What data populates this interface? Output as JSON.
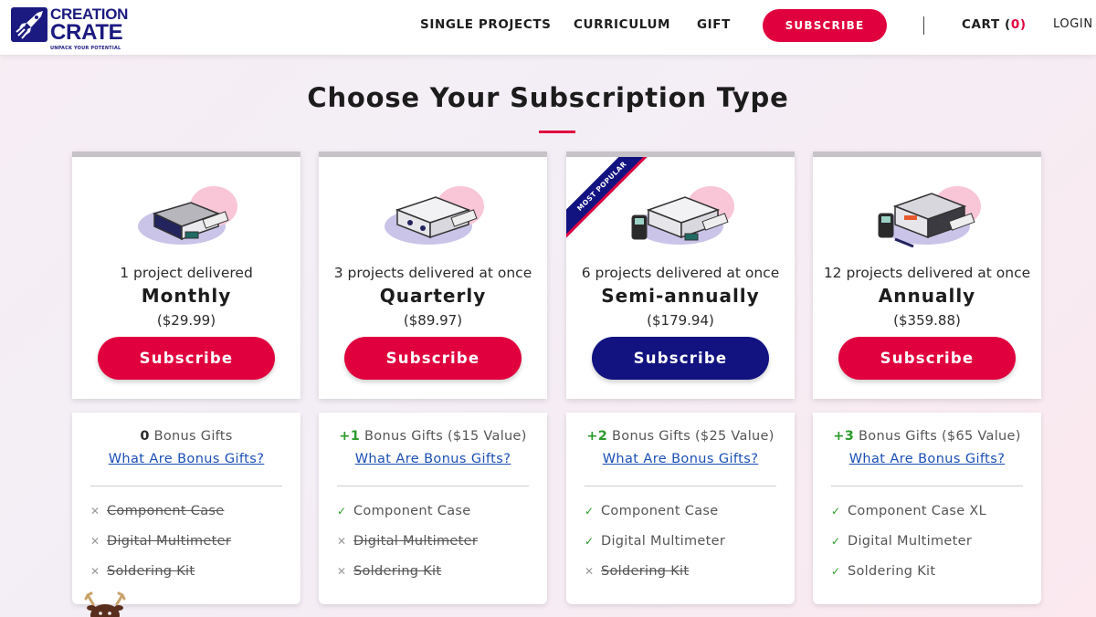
{
  "brand": {
    "line1": "CREATION",
    "line2": "CRATE",
    "tagline": "UNPACK YOUR POTENTIAL"
  },
  "nav": {
    "single_projects": "SINGLE PROJECTS",
    "curriculum": "CURRICULUM",
    "gift": "GIFT",
    "subscribe": "SUBSCRIBE",
    "cart_label": "CART (",
    "cart_count": "0",
    "cart_close": ")",
    "login": "LOGIN"
  },
  "page": {
    "title": "Choose Your Subscription Type"
  },
  "plans": [
    {
      "desc": "1 project delivered",
      "name": "Monthly",
      "price": "($29.99)",
      "button": "Subscribe",
      "bonus_count": "0",
      "bonus_text": " Bonus Gifts",
      "bonus_link": "What Are Bonus Gifts?",
      "features": [
        {
          "label": "Component Case",
          "included": false
        },
        {
          "label": "Digital Multimeter",
          "included": false
        },
        {
          "label": "Soldering Kit",
          "included": false
        }
      ]
    },
    {
      "desc": "3 projects delivered at once",
      "name": "Quarterly",
      "price": "($89.97)",
      "button": "Subscribe",
      "bonus_count": "+1",
      "bonus_text": " Bonus Gifts ($15 Value)",
      "bonus_link": "What Are Bonus Gifts?",
      "features": [
        {
          "label": "Component Case",
          "included": true
        },
        {
          "label": "Digital Multimeter",
          "included": false
        },
        {
          "label": "Soldering Kit",
          "included": false
        }
      ]
    },
    {
      "ribbon": "MOST POPULAR",
      "desc": "6 projects delivered at once",
      "name": "Semi-annually",
      "price": "($179.94)",
      "button": "Subscribe",
      "bonus_count": "+2",
      "bonus_text": " Bonus Gifts ($25 Value)",
      "bonus_link": "What Are Bonus Gifts?",
      "features": [
        {
          "label": "Component Case",
          "included": true
        },
        {
          "label": "Digital Multimeter",
          "included": true
        },
        {
          "label": "Soldering Kit",
          "included": false
        }
      ]
    },
    {
      "desc": "12 projects delivered at once",
      "name": "Annually",
      "price": "($359.88)",
      "button": "Subscribe",
      "bonus_count": "+3",
      "bonus_text": " Bonus Gifts ($65 Value)",
      "bonus_link": "What Are Bonus Gifts?",
      "features": [
        {
          "label": "Component Case XL",
          "included": true
        },
        {
          "label": "Digital Multimeter",
          "included": true
        },
        {
          "label": "Soldering Kit",
          "included": true
        }
      ]
    }
  ],
  "icons": {
    "check": "check-icon",
    "cross": "x-icon",
    "logo": "rocket-logo-icon",
    "mascot": "reindeer-icon"
  },
  "colors": {
    "accent_red": "#e0003e",
    "navy": "#121380",
    "brand_navy": "#1b1a80",
    "bonus_green": "#2a9a2a",
    "link_blue": "#1a4fb5"
  }
}
